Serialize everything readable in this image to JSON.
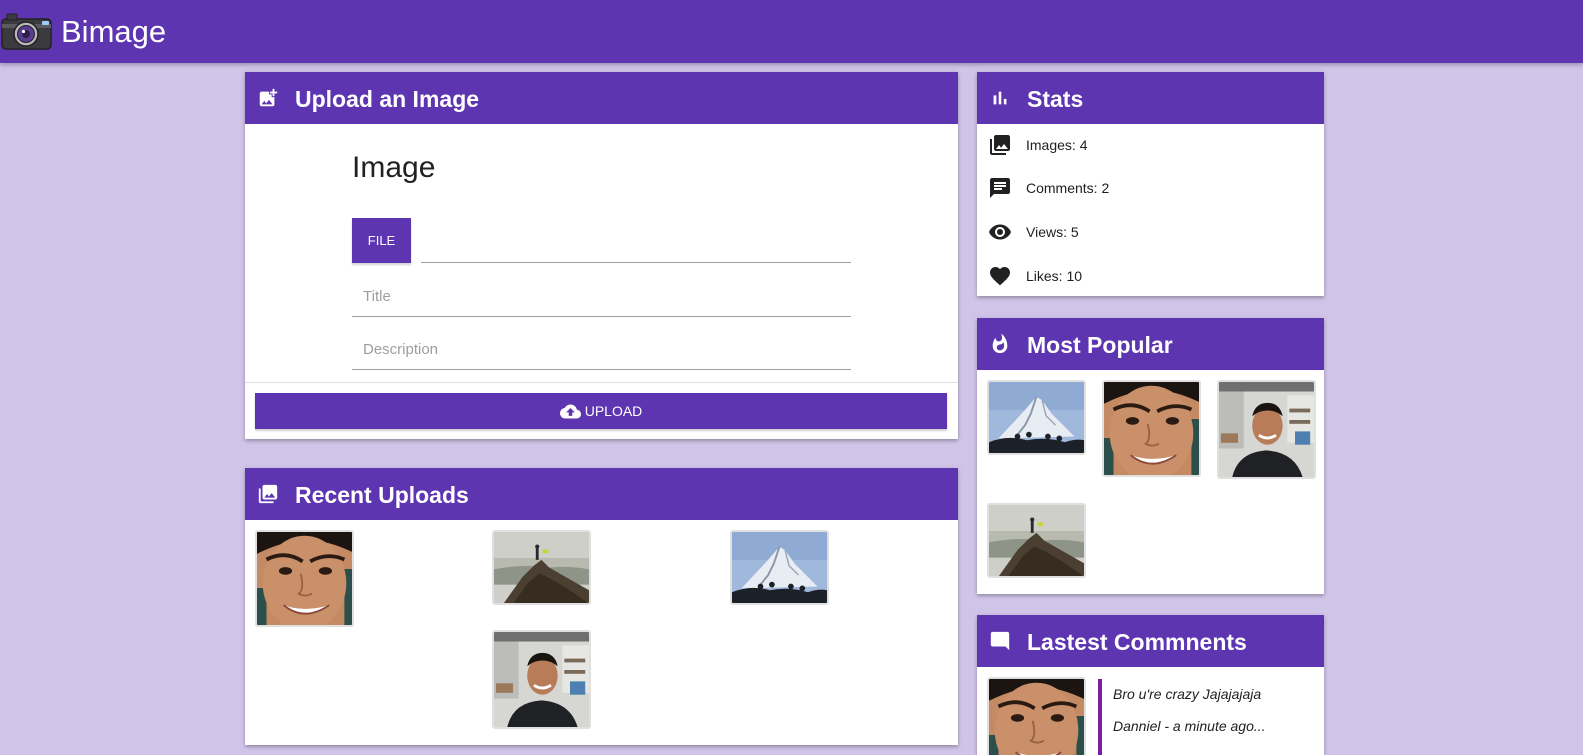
{
  "app": {
    "brand_name": "Bimage",
    "brand_icon": "camera-icon"
  },
  "colors": {
    "primary": "#5e35b1",
    "background": "#d1c4e9",
    "quote_accent": "#7b1fa2"
  },
  "upload": {
    "header_title": "Upload an Image",
    "header_icon": "add-photo-icon",
    "form_heading": "Image",
    "file_button_label": "FILE",
    "title_placeholder": "Title",
    "description_placeholder": "Description",
    "upload_button_label": "UPLOAD",
    "upload_icon": "cloud-upload-icon"
  },
  "recent": {
    "header_title": "Recent Uploads",
    "header_icon": "photo-library-icon",
    "images": [
      {
        "kind": "face-closeup"
      },
      {
        "kind": "mountain-peak-person"
      },
      {
        "kind": "snowy-mountain"
      },
      {
        "kind": "selfie-office"
      }
    ]
  },
  "stats": {
    "header_title": "Stats",
    "header_icon": "bar-chart-icon",
    "items": [
      {
        "icon": "photo-library-icon",
        "label": "Images: 4"
      },
      {
        "icon": "comment-icon",
        "label": "Comments: 2"
      },
      {
        "icon": "eye-icon",
        "label": "Views: 5"
      },
      {
        "icon": "heart-icon",
        "label": "Likes: 10"
      }
    ]
  },
  "popular": {
    "header_title": "Most Popular",
    "header_icon": "flame-icon",
    "images": [
      {
        "kind": "snowy-mountain"
      },
      {
        "kind": "face-closeup"
      },
      {
        "kind": "selfie-office"
      },
      {
        "kind": "mountain-peak-person"
      }
    ]
  },
  "comments": {
    "header_title": "Lastest Commnents",
    "header_icon": "comment-icon",
    "items": [
      {
        "text": "Bro u're crazy Jajajajaja",
        "meta": "Danniel - a minute ago..."
      }
    ]
  }
}
